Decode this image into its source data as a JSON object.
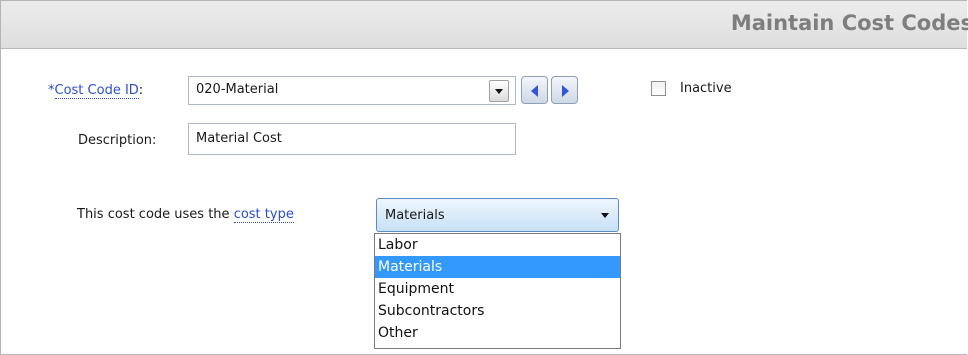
{
  "header": {
    "title": "Maintain Cost Codes"
  },
  "cost_code": {
    "required_marker": "*",
    "label": "Cost Code ID",
    "colon": ":",
    "value": "020-Material"
  },
  "inactive": {
    "label": "Inactive",
    "checked": false
  },
  "description": {
    "label": "Description:",
    "value": "Material Cost"
  },
  "cost_type": {
    "prefix": "This cost code uses the",
    "link": "cost type",
    "selected": "Materials",
    "options": [
      "Labor",
      "Materials",
      "Equipment",
      "Subcontractors",
      "Other"
    ]
  },
  "colors": {
    "link": "#2a4fd0",
    "selection": "#3399ff",
    "title": "#7e7e7e",
    "nav_arrow": "#2f56d6"
  }
}
